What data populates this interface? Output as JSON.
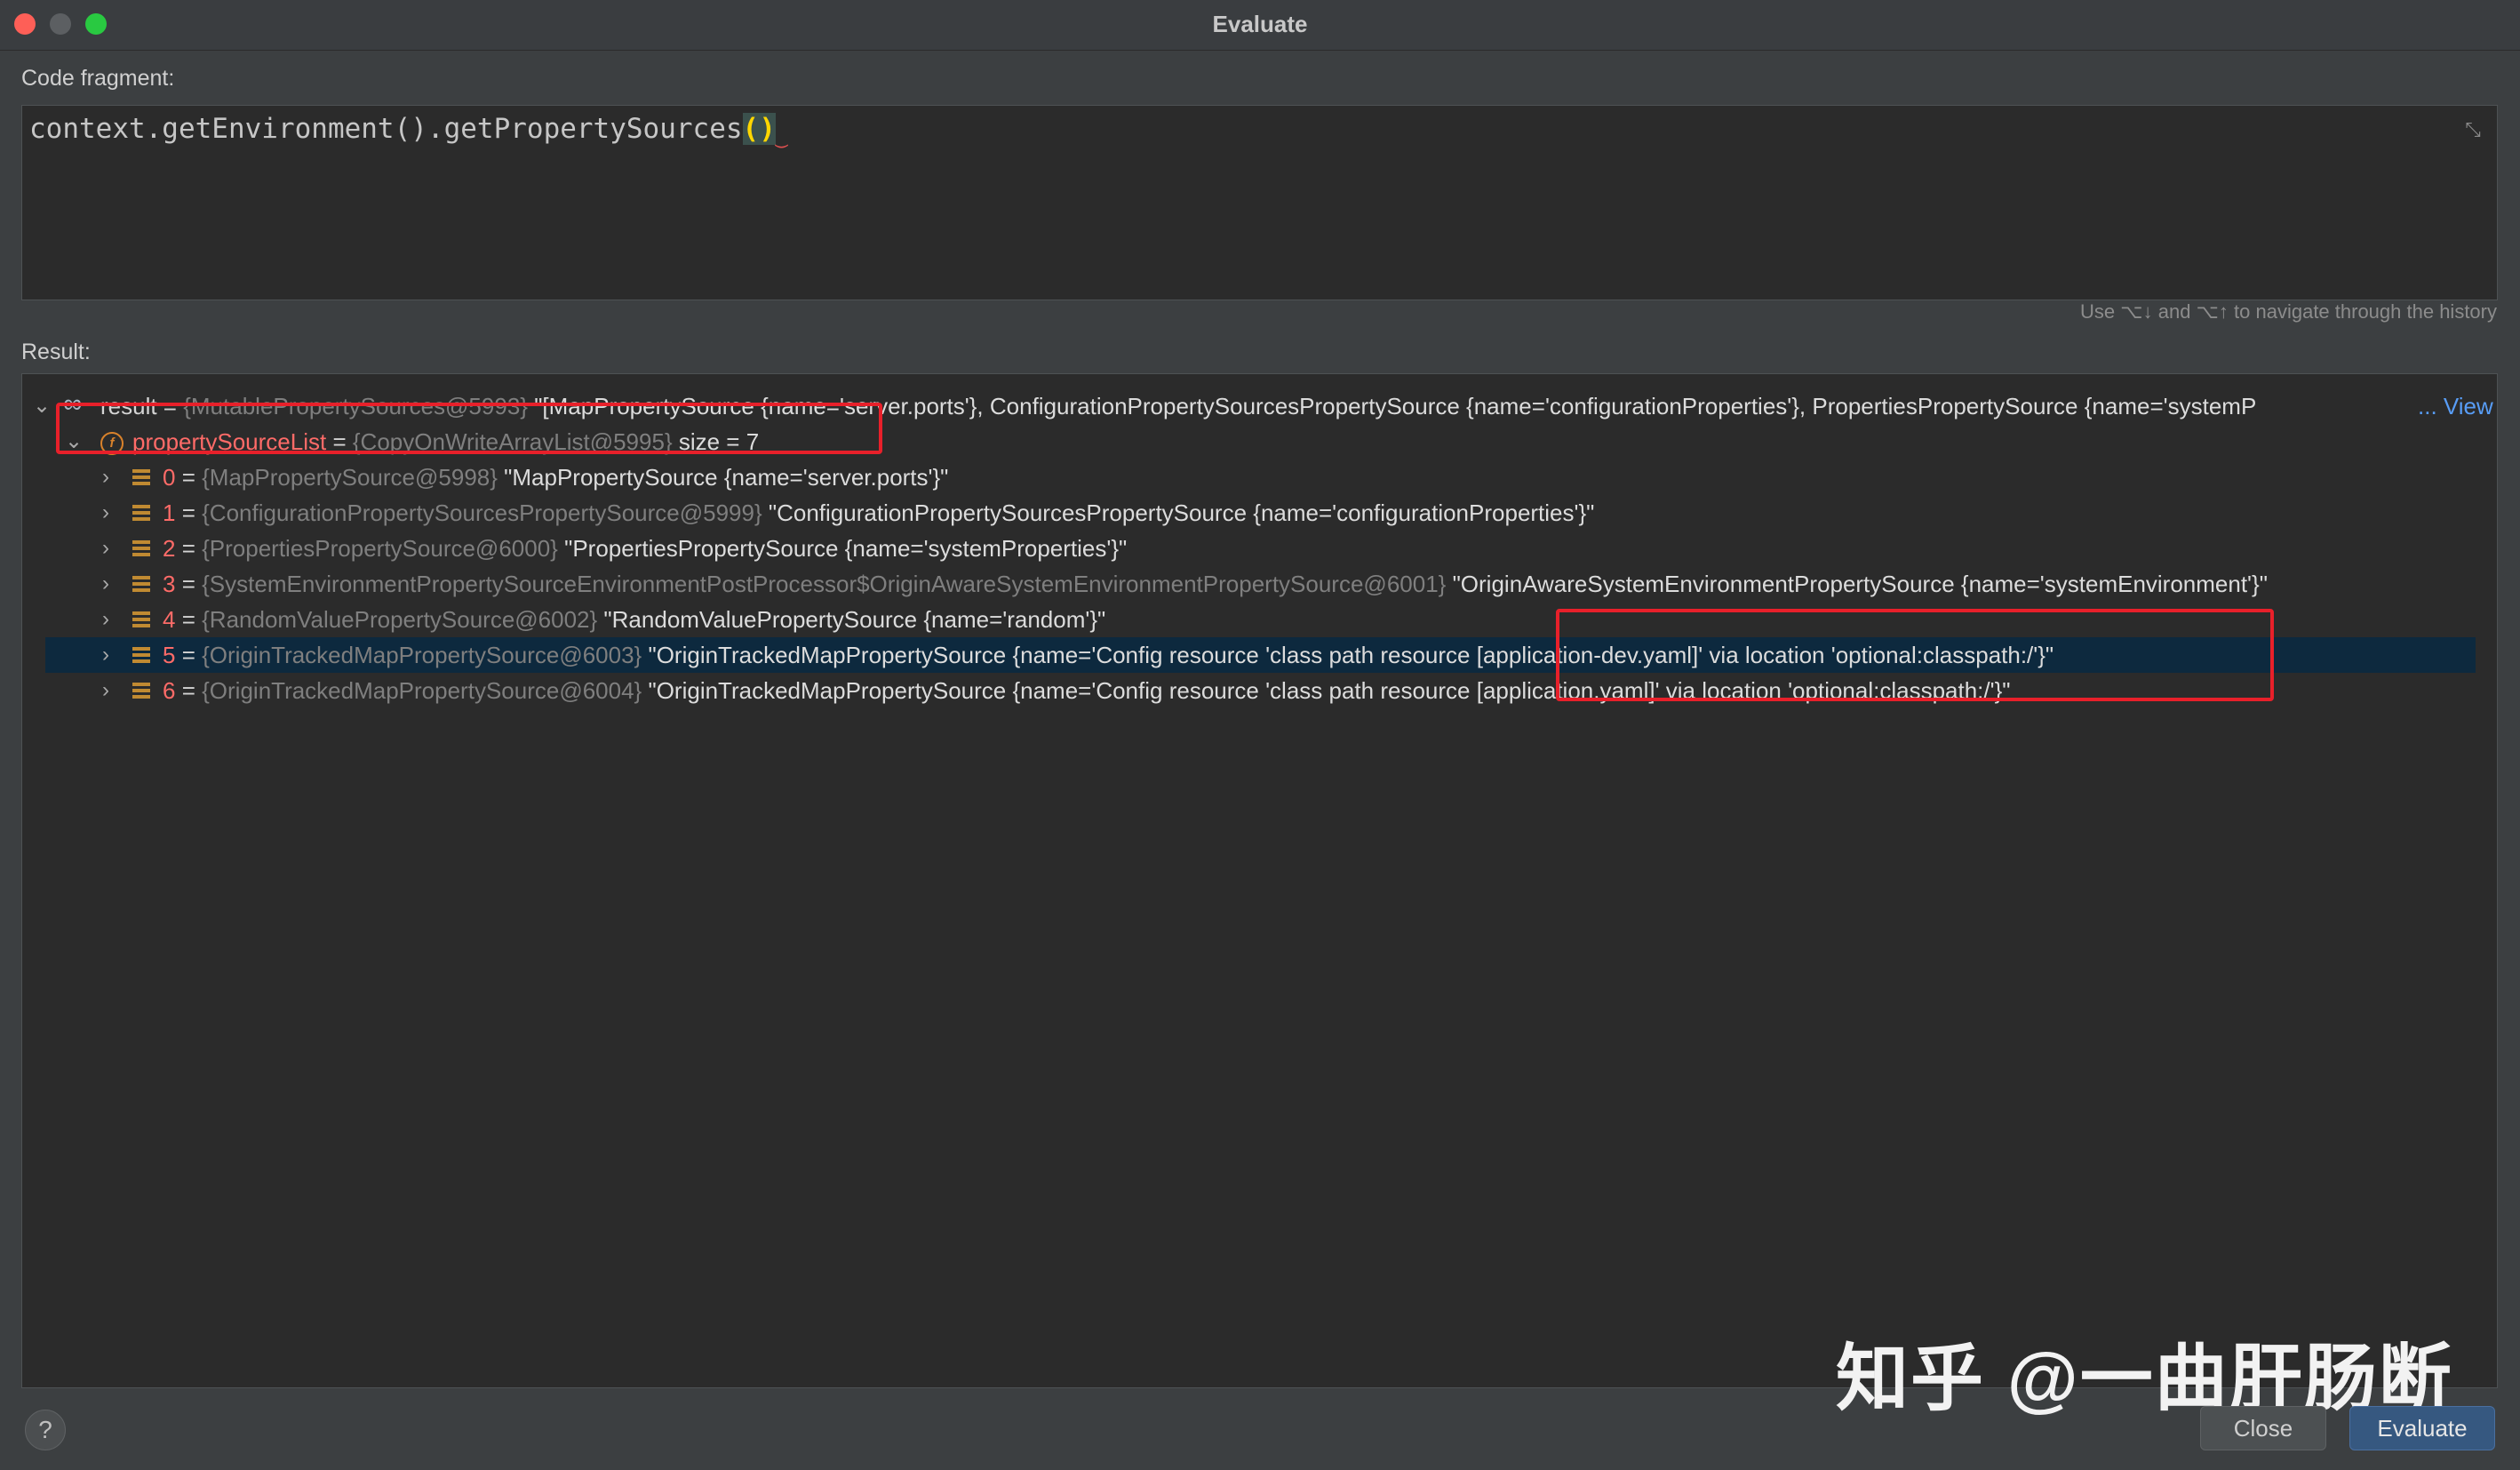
{
  "window": {
    "title": "Evaluate"
  },
  "code_fragment": {
    "label": "Code fragment:",
    "code_prefix": "context.getEnvironment().getPropertySources",
    "code_parens": "()",
    "history_hint": "Use ⌥↓ and ⌥↑ to navigate through the history"
  },
  "result": {
    "label": "Result:",
    "root": {
      "name": "result",
      "eq": " = ",
      "type": "{MutablePropertySources@5993}",
      "value": " \"[MapPropertySource {name='server.ports'}, ConfigurationPropertySourcesPropertySource {name='configurationProperties'}, PropertiesPropertySource {name='systemP",
      "more": "... View"
    },
    "field": {
      "name": "propertySourceList",
      "eq": " = ",
      "type": "{CopyOnWriteArrayList@5995}",
      "size": "  size = 7"
    },
    "items": [
      {
        "idx": "0",
        "eq": " = ",
        "type": "{MapPropertySource@5998}",
        "value": " \"MapPropertySource {name='server.ports'}\""
      },
      {
        "idx": "1",
        "eq": " = ",
        "type": "{ConfigurationPropertySourcesPropertySource@5999}",
        "value": " \"ConfigurationPropertySourcesPropertySource {name='configurationProperties'}\""
      },
      {
        "idx": "2",
        "eq": " = ",
        "type": "{PropertiesPropertySource@6000}",
        "value": " \"PropertiesPropertySource {name='systemProperties'}\""
      },
      {
        "idx": "3",
        "eq": " = ",
        "type": "{SystemEnvironmentPropertySourceEnvironmentPostProcessor$OriginAwareSystemEnvironmentPropertySource@6001}",
        "value": " \"OriginAwareSystemEnvironmentPropertySource {name='systemEnvironment'}\""
      },
      {
        "idx": "4",
        "eq": " = ",
        "type": "{RandomValuePropertySource@6002}",
        "value": " \"RandomValuePropertySource {name='random'}\""
      },
      {
        "idx": "5",
        "eq": " = ",
        "type": "{OriginTrackedMapPropertySource@6003}",
        "value": " \"OriginTrackedMapPropertySource {name='Config resource 'class path resource [application-dev.yaml]' via location 'optional:classpath:/'}\""
      },
      {
        "idx": "6",
        "eq": " = ",
        "type": "{OriginTrackedMapPropertySource@6004}",
        "value": " \"OriginTrackedMapPropertySource {name='Config resource 'class path resource [application.yaml]' via location 'optional:classpath:/'}\""
      }
    ]
  },
  "buttons": {
    "help": "?",
    "close": "Close",
    "evaluate": "Evaluate"
  },
  "watermark": "知乎 @一曲肝肠断",
  "colors": {
    "highlight_box": "#e8202a",
    "selected_row": "#0d293e",
    "accent_button": "#365880"
  }
}
